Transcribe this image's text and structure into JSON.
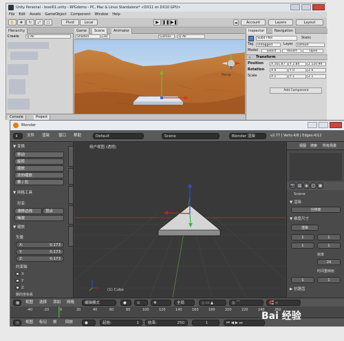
{
  "unity": {
    "title": "Unity Personal - level01.unity - RPGdemo - PC, Mac & Linux Standalone* <DX11 on DX10 GPU>",
    "menu": [
      "File",
      "Edit",
      "Assets",
      "GameObject",
      "Component",
      "Window",
      "Help"
    ],
    "toolbar": {
      "pivot": "Pivot",
      "local": "Local",
      "account": "Account",
      "layers": "Layers",
      "layout": "Layout"
    },
    "hierarchy": {
      "tab": "Hierarchy",
      "create": "Create",
      "search": "Q All"
    },
    "scene": {
      "tabs": [
        "Game",
        "Scene",
        "Animator"
      ],
      "shaded": "Shaded",
      "twod": "2D",
      "gizmos": "Gizmos",
      "search": "Q All",
      "persp": "Persp"
    },
    "inspector": {
      "tabs": [
        "Inspector",
        "Navigation"
      ],
      "object_name": "Sub4 Ffbs",
      "static": "Static",
      "tag_label": "Tag",
      "tag_value": "Untagged",
      "layer_label": "Layer",
      "layer_value": "Default",
      "model_label": "Model",
      "select": "Select",
      "revert": "Revert",
      "open": "Open",
      "transform_title": "Transform",
      "position_label": "Position",
      "rotation_label": "Rotation",
      "scale_label": "Scale",
      "position": [
        "X 161.87",
        "Y 2.84",
        "Z 120.99"
      ],
      "rotation": [
        "X 0",
        "Y 0",
        "Z 0"
      ],
      "scale": [
        "X 1",
        "Y 1",
        "Z 1"
      ],
      "add_component": "Add Component"
    },
    "bottom_tabs": [
      "Console",
      "Project"
    ]
  },
  "blender": {
    "title": "Blender",
    "menu": [
      "文件",
      "渲染",
      "窗口",
      "帮助"
    ],
    "layout": "Default",
    "scene": "Scene",
    "engine": "Blender 渲染",
    "version": "v2.77 | Verts:4/8 | Edges:4/12",
    "toolshelf": {
      "transform_header": "▼ 变换",
      "transform_buttons": [
        "移动",
        "旋转",
        "缩放",
        "法向缩放",
        "推 / 拉"
      ],
      "mesh_tools_header": "▼ 网格工具",
      "deform_label": "形变:",
      "slide_edge": "滑移边线",
      "vertex": "顶点",
      "noise": "噪波",
      "scale_header": "▼ 缩放",
      "vector_label": "矢量",
      "x": "X:",
      "x_val": "0.173",
      "y": "Y:",
      "y_val": "0.173",
      "z": "Z:",
      "z_val": "0.173",
      "constraint_label": "约束轴",
      "axis_x": "X",
      "axis_y": "Y",
      "axis_z": "Z",
      "orientation": "朝向坐标系"
    },
    "viewport": {
      "label": "用户视图 (透视)",
      "object_label": "(1) Cube"
    },
    "properties": {
      "tabs": [
        "视图",
        "搜索",
        "所有场景"
      ],
      "scene_label": "Scene",
      "render_header": "▼ 渲染",
      "render_res": "分辨率",
      "dimensions_header": "▼ 维度尺寸",
      "preset": "渲染",
      "res_x": "1",
      "res_y": "1",
      "fps": "24",
      "frame_rate": "帧率",
      "time_remap": "时间重映射",
      "anti_alias": "▶ 抗锯齿"
    },
    "view3d_footer": [
      "视图",
      "选择",
      "添加",
      "网格"
    ],
    "mode": "编辑模式",
    "pivot": "全局",
    "timeline_ticks": [
      "-40",
      "-20",
      "0",
      "20",
      "40",
      "60",
      "80",
      "100",
      "120",
      "140",
      "160",
      "180",
      "200",
      "220",
      "240",
      "260"
    ],
    "timeline_footer": [
      "视图",
      "标记",
      "帧",
      "回放"
    ],
    "start_label": "起始:",
    "start": "1",
    "end_label": "结束:",
    "end": "250",
    "current": "1"
  },
  "watermark": "Bai 经验"
}
